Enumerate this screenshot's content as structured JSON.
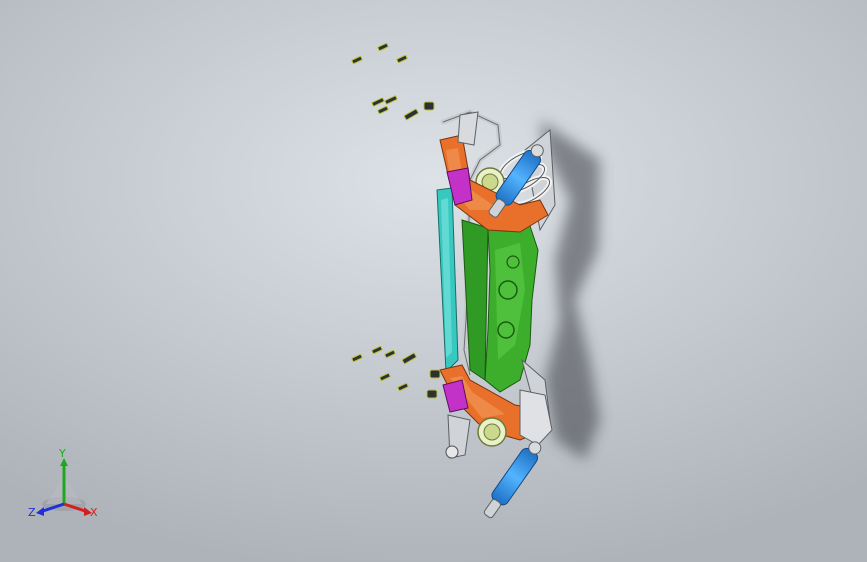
{
  "triad": {
    "x_label": "X",
    "y_label": "Y",
    "z_label": "Z"
  },
  "colors": {
    "background": "#c8cdd3",
    "axis_x": "#d22020",
    "axis_y": "#1fa81f",
    "axis_z": "#2030d8",
    "subframe_green": "#3cae2c",
    "rail_cyan": "#37c9c0",
    "arm_orange": "#e8702a",
    "bracket_magenta": "#c431c8",
    "shock_blue": "#2f8fe8",
    "spring_white": "#eeeeee"
  }
}
